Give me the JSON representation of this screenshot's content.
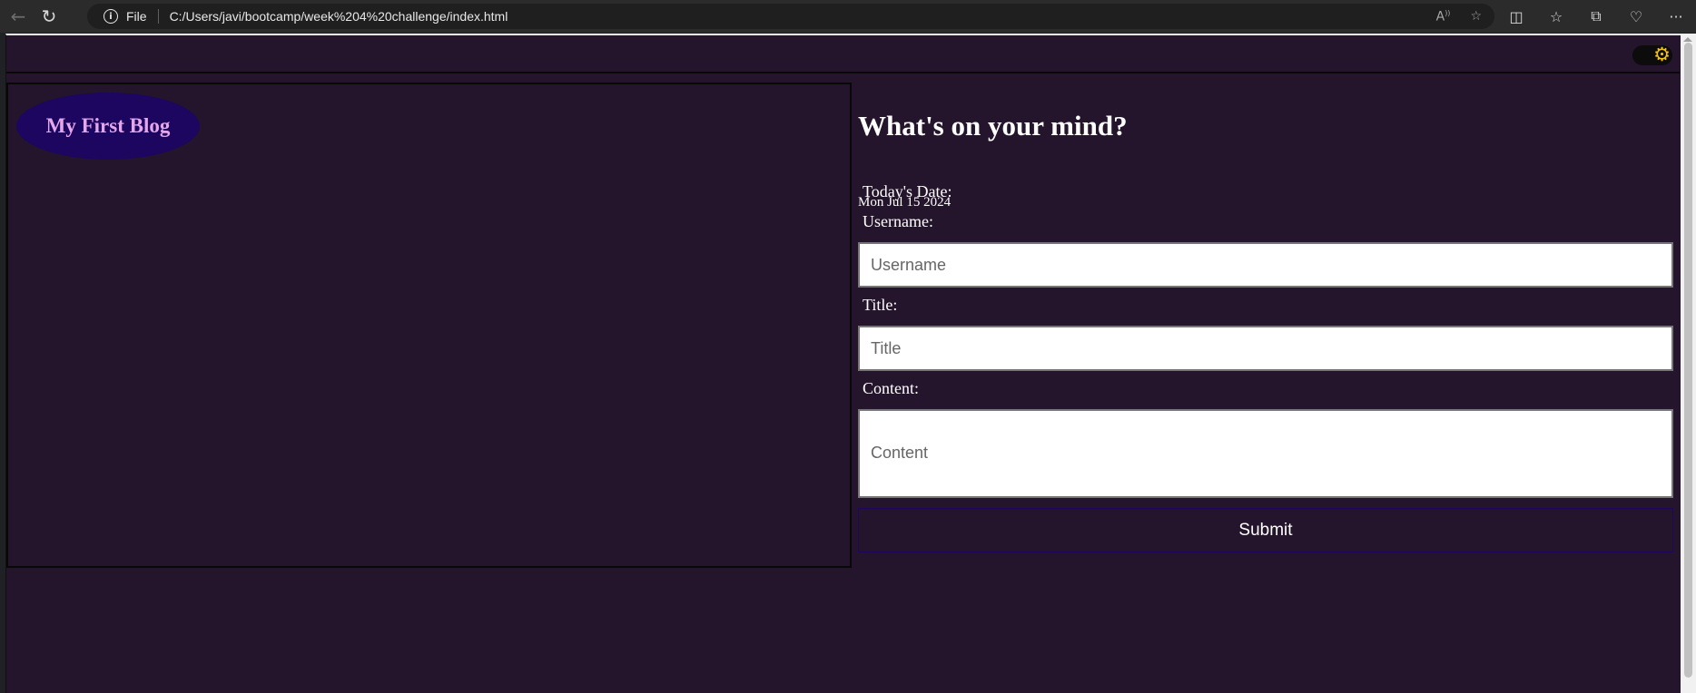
{
  "browser": {
    "file_label": "File",
    "url": "C:/Users/javi/bootcamp/week%204%20challenge/index.html",
    "icons": [
      "back-arrow-icon",
      "refresh-icon",
      "info-icon",
      "read-aloud-icon",
      "favorite-star-icon",
      "split-screen-icon",
      "favorites-icon",
      "collections-icon",
      "browser-essentials-icon",
      "more-icon"
    ]
  },
  "header": {
    "theme_toggle_icon": "sun-icon"
  },
  "left_panel": {
    "blog_title": "My First Blog"
  },
  "form": {
    "heading": "What's on your mind?",
    "date_label": "Today's Date:",
    "date_value": "Mon Jul 15 2024",
    "username_label": "Username:",
    "username_placeholder": "Username",
    "title_label": "Title:",
    "title_placeholder": "Title",
    "content_label": "Content:",
    "content_placeholder": "Content",
    "submit_label": "Submit"
  },
  "colors": {
    "page_background": "#24142c",
    "badge_background": "#1c0660",
    "badge_text": "#e4a8ea",
    "sun_icon": "#f2c21b"
  }
}
